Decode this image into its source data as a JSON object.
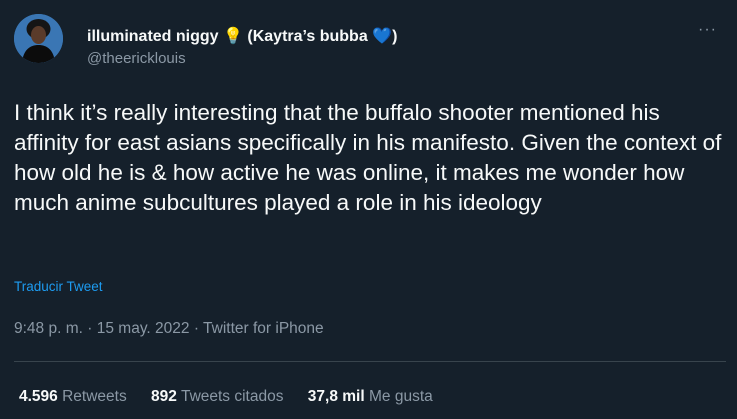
{
  "author": {
    "display_name": "illuminated niggy",
    "name_emoji_1": "💡",
    "name_suffix": "(Kaytra’s bubba",
    "name_emoji_2": "💙",
    "name_close": ")",
    "handle": "@theericklouis"
  },
  "more_label": "···",
  "tweet": {
    "text": "I think it’s really interesting that the buffalo shooter mentioned his affinity for east asians specifically in his manifesto. Given the context of how old he is & how active he was online, it makes me wonder how much anime subcultures played a role in his ideology",
    "translate_label": "Traducir Tweet"
  },
  "meta": {
    "time": "9:48 p. m.",
    "separator": "·",
    "date": "15 may. 2022",
    "source": "Twitter for iPhone"
  },
  "stats": {
    "retweets_count": "4.596",
    "retweets_label": "Retweets",
    "quotes_count": "892",
    "quotes_label": "Tweets citados",
    "likes_count": "37,8 mil",
    "likes_label": "Me gusta"
  },
  "colors": {
    "background": "#15202b",
    "text": "#f7f9f9",
    "secondary": "#8b98a5",
    "accent": "#1d9bf0"
  }
}
